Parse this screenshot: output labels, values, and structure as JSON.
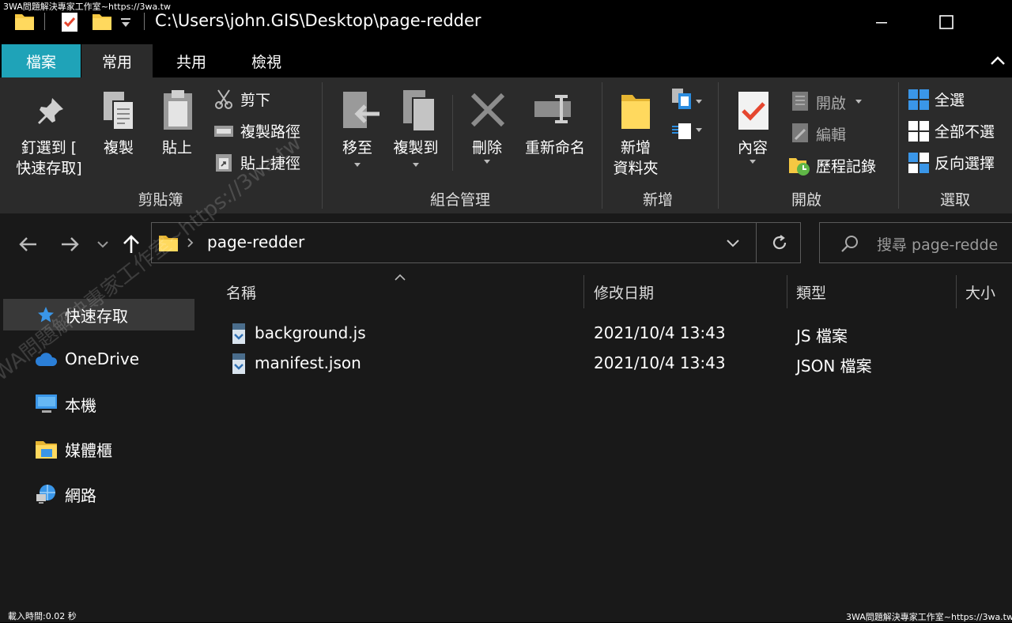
{
  "watermark": "3WA問題解決專家工作室~https://3wa.tw",
  "titlebar": {
    "path": "C:\\Users\\john.GIS\\Desktop\\page-redder",
    "accent": "#1fa3b8"
  },
  "tabs": [
    {
      "label": "檔案"
    },
    {
      "label": "常用"
    },
    {
      "label": "共用"
    },
    {
      "label": "檢視"
    }
  ],
  "ribbon": {
    "clipboard": {
      "pin_label_1": "釘選到 [",
      "pin_label_2": "快速存取]",
      "copy": "複製",
      "paste": "貼上",
      "cut": "剪下",
      "copy_path": "複製路徑",
      "paste_shortcut": "貼上捷徑",
      "group": "剪貼簿"
    },
    "organize": {
      "move_to": "移至",
      "copy_to": "複製到",
      "delete": "刪除",
      "rename": "重新命名",
      "group": "組合管理"
    },
    "new": {
      "new_folder_1": "新增",
      "new_folder_2": "資料夾",
      "group": "新增"
    },
    "open": {
      "properties": "內容",
      "open": "開啟",
      "edit": "編輯",
      "history": "歷程記錄",
      "group": "開啟"
    },
    "select": {
      "select_all": "全選",
      "select_none": "全部不選",
      "invert": "反向選擇",
      "group": "選取"
    }
  },
  "address": {
    "current": "page-redder",
    "search_placeholder": "搜尋 page-redde"
  },
  "nav": [
    {
      "label": "快速存取"
    },
    {
      "label": "OneDrive"
    },
    {
      "label": "本機"
    },
    {
      "label": "媒體櫃"
    },
    {
      "label": "網路"
    }
  ],
  "columns": {
    "name": "名稱",
    "date": "修改日期",
    "type": "類型",
    "size": "大小"
  },
  "files": [
    {
      "name": "background.js",
      "date": "2021/10/4 13:43",
      "type": "JS 檔案"
    },
    {
      "name": "manifest.json",
      "date": "2021/10/4 13:43",
      "type": "JSON 檔案"
    }
  ],
  "status": {
    "load_time": "載入時間:0.02 秒"
  }
}
